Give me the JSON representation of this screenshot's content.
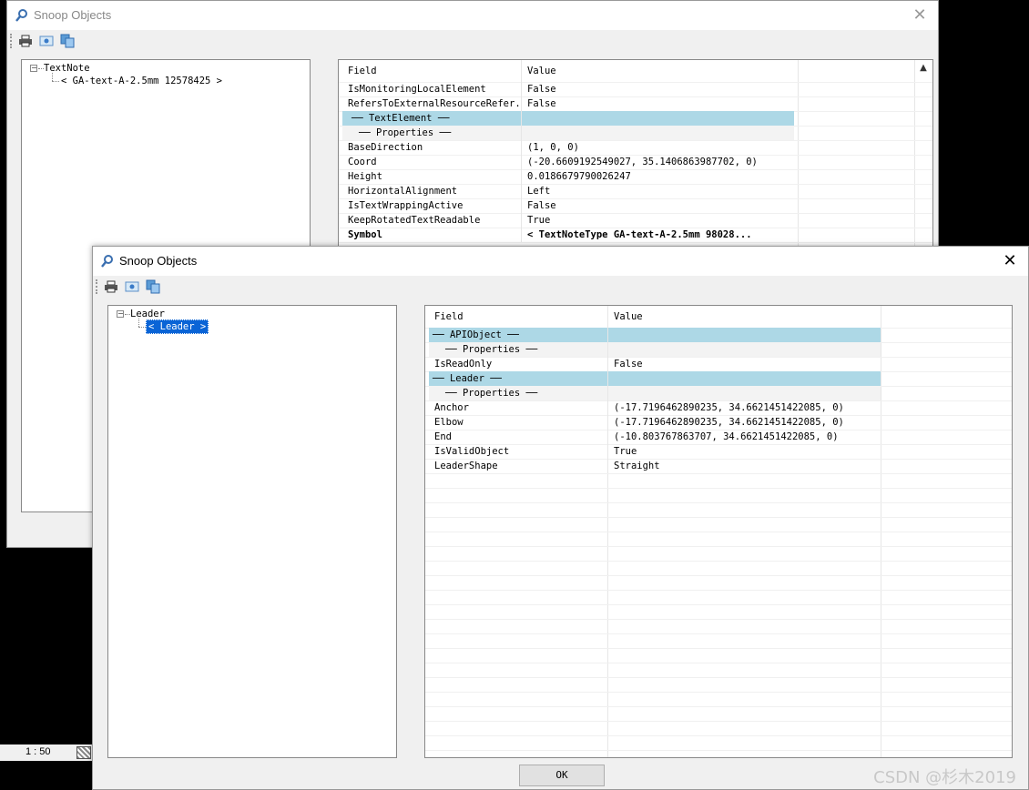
{
  "status": {
    "scale": "1 : 50"
  },
  "back_window": {
    "title": "Snoop Objects",
    "close_glyph": "✕",
    "toolbar": [
      "print-icon",
      "snapshot-icon",
      "copy-icon"
    ],
    "tree": {
      "root": "TextNote",
      "child": "< GA-text-A-2.5mm  12578425 >"
    },
    "grid": {
      "header": {
        "field": "Field",
        "value": "Value"
      },
      "rows": [
        {
          "field": "IsMonitoringLocalElement",
          "value": "False"
        },
        {
          "field": "RefersToExternalResourceRefer...",
          "value": "False"
        },
        {
          "field": "── TextElement ──",
          "value": ""
        },
        {
          "field": "── Properties ──",
          "value": ""
        },
        {
          "field": "BaseDirection",
          "value": "(1, 0, 0)"
        },
        {
          "field": "Coord",
          "value": "(-20.6609192549027, 35.1406863987702, 0)"
        },
        {
          "field": "Height",
          "value": "0.0186679790026247"
        },
        {
          "field": "HorizontalAlignment",
          "value": "Left"
        },
        {
          "field": "IsTextWrappingActive",
          "value": "False"
        },
        {
          "field": "KeepRotatedTextReadable",
          "value": "True"
        },
        {
          "field": "Symbol",
          "value": "< TextNoteType  GA-text-A-2.5mm  98028..."
        }
      ]
    }
  },
  "front_window": {
    "title": "Snoop Objects",
    "close_glyph": "✕",
    "toolbar": [
      "print-icon",
      "snapshot-icon",
      "copy-icon"
    ],
    "tree": {
      "root": "Leader",
      "child": "< Leader >"
    },
    "grid": {
      "header": {
        "field": "Field",
        "value": "Value"
      },
      "rows": [
        {
          "field": "── APIObject ──",
          "value": ""
        },
        {
          "field": "── Properties ──",
          "value": ""
        },
        {
          "field": "IsReadOnly",
          "value": "False"
        },
        {
          "field": "── Leader ──",
          "value": ""
        },
        {
          "field": "── Properties ──",
          "value": ""
        },
        {
          "field": "Anchor",
          "value": "(-17.7196462890235, 34.6621451422085, 0)"
        },
        {
          "field": "Elbow",
          "value": "(-17.7196462890235, 34.6621451422085, 0)"
        },
        {
          "field": "End",
          "value": "(-10.803767863707, 34.6621451422085, 0)"
        },
        {
          "field": "IsValidObject",
          "value": "True"
        },
        {
          "field": "LeaderShape",
          "value": "Straight"
        }
      ]
    },
    "ok_label": "OK"
  },
  "watermark": "CSDN @杉木2019",
  "colors": {
    "section_blue": "#add8e6",
    "section_gray": "#f3f3f3",
    "selection": "#0a64d6"
  }
}
